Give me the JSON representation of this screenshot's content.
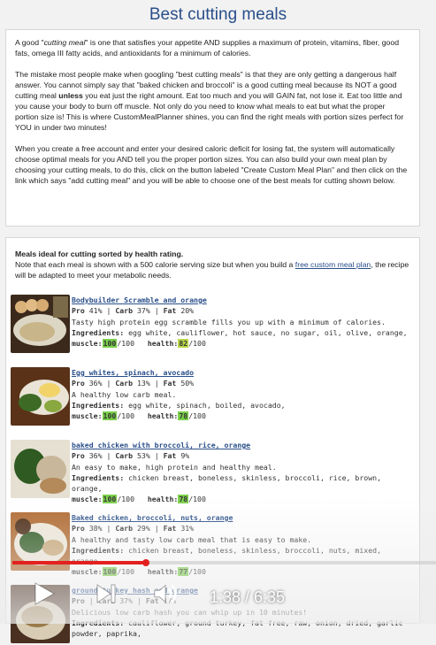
{
  "page_title": "Best cutting meals",
  "intro": {
    "p1_pre": "A good \"",
    "p1_em": "cutting meal",
    "p1_post": "\" is one that satisfies your appetite AND supplies a maximum of protein, vitamins, fiber, good fats, omega III fatty acids, and antioxidants for a minimum of calories.",
    "p2_pre": "The mistake most people make when googling \"best cutting meals\" is that they are only getting a dangerous half answer. You cannot simply say that \"baked chicken and broccoli\" is a good cutting meal because its NOT a good cutting meal ",
    "p2_bold": "unless",
    "p2_post": " you eat just the right amount. Eat too much and you will GAIN fat, not lose it. Eat too little and you cause your body to burn off muscle. Not only do you need to know what meals to eat but what the proper portion size is! This is where CustomMealPlanner shines, you can find the right meals with portion sizes perfect for YOU in under two minutes!",
    "p3": "When you create a free account and enter your desired caloric deficit for losing fat, the system will automatically choose optimal meals for you AND tell you the proper portion sizes. You can also build your own meal plan by choosing your cutting meals, to do this, click on the button labeled \"Create Custom Meal Plan\" and then click on the link which says \"add cutting meal\" and you will be able to choose one of the best meals for cutting shown below."
  },
  "meals_section": {
    "heading": "Meals ideal for cutting sorted by health rating.",
    "note_pre": "Note that each meal is shown with a 500 calorie serving size but when you build a ",
    "note_link": "free custom meal plan",
    "note_post": ", the recipe will be adapted to meet your metabolic needs."
  },
  "labels": {
    "pro": "Pro",
    "carb": "Carb",
    "fat": "Fat",
    "ingredients": "Ingredients:",
    "muscle": "muscle:",
    "health": "health:",
    "out_of": "/100"
  },
  "meals": [
    {
      "name": "Bodybuilder Scramble and orange",
      "pro": "41%",
      "carb": "37%",
      "fat": "20%",
      "desc": "Tasty high protein egg scramble fills you up with a minimum of calories.",
      "ingredients": "egg white, cauliflower, hot sauce, no sugar, oil, olive, orange,",
      "muscle": "100",
      "health": "82"
    },
    {
      "name": "Egg whites, spinach, avocado",
      "pro": "36%",
      "carb": "13%",
      "fat": "50%",
      "desc": "A healthy low carb meal.",
      "ingredients": "egg white, spinach, boiled, avocado,",
      "muscle": "100",
      "health": "78"
    },
    {
      "name": "baked chicken with broccoli, rice, orange",
      "pro": "36%",
      "carb": "53%",
      "fat": "9%",
      "desc": "An easy to make, high protein and healthy meal.",
      "ingredients": "chicken breast, boneless, skinless, broccoli, rice, brown, orange,",
      "muscle": "100",
      "health": "78"
    },
    {
      "name": "Baked chicken, broccoli, nuts, orange",
      "pro": "38%",
      "carb": "29%",
      "fat": "31%",
      "desc": "A healthy and tasty low carb meal that is easy to make.",
      "ingredients": "chicken breast, boneless, skinless, broccoli, nuts, mixed, orange,",
      "muscle": "100",
      "health": "77"
    },
    {
      "name": "ground turkey hash and orange",
      "pro": "",
      "carb": "37%",
      "fat": "17%",
      "desc": "Delicious low carb hash you can whip up in 10 minutes!",
      "ingredients": "cauliflower, ground turkey, fat free, raw, onion, dried, garlic powder, paprika,",
      "muscle": "",
      "health": ""
    }
  ],
  "video": {
    "time": "1:38 / 6:35",
    "progress": 0.25,
    "progress_color": "#e32020",
    "icons": [
      "play-icon",
      "next-icon",
      "volume-icon"
    ]
  }
}
